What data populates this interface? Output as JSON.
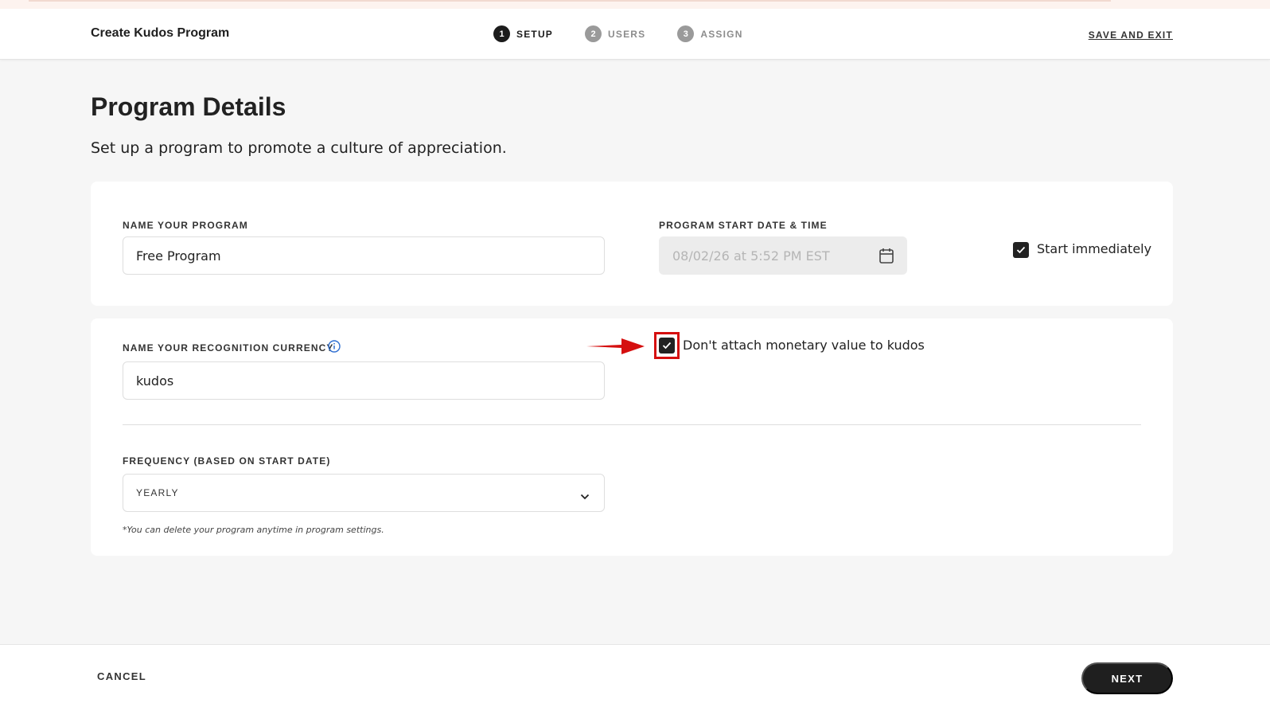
{
  "header": {
    "title": "Create Kudos Program",
    "steps": [
      {
        "number": "1",
        "label": "SETUP",
        "active": true
      },
      {
        "number": "2",
        "label": "USERS",
        "active": false
      },
      {
        "number": "3",
        "label": "ASSIGN",
        "active": false
      }
    ],
    "save_exit_label": "SAVE AND EXIT"
  },
  "main": {
    "title": "Program Details",
    "subtitle": "Set up a program to promote a culture of appreciation."
  },
  "program_card": {
    "name_label": "NAME YOUR PROGRAM",
    "name_value": "Free Program",
    "start_label": "PROGRAM START DATE & TIME",
    "start_value": "08/02/26 at 5:52 PM EST",
    "start_immediately_label": "Start immediately",
    "start_immediately_checked": true
  },
  "currency_card": {
    "currency_label": "NAME YOUR RECOGNITION CURRENCY",
    "currency_value": "kudos",
    "no_monetary_label": "Don't attach monetary value to kudos",
    "no_monetary_checked": true,
    "frequency_label": "FREQUENCY (BASED ON START DATE)",
    "frequency_value": "YEARLY",
    "footnote": "*You can delete your program anytime in program settings."
  },
  "footer": {
    "cancel_label": "CANCEL",
    "next_label": "NEXT"
  },
  "colors": {
    "accent_dark": "#1f1f1f",
    "annotation_red": "#d50f0f",
    "info_blue": "#2f6fd1"
  },
  "icons": {
    "calendar": "calendar-icon",
    "info": "info-icon",
    "chevron": "chevron-down-icon",
    "check": "checkmark-icon"
  }
}
